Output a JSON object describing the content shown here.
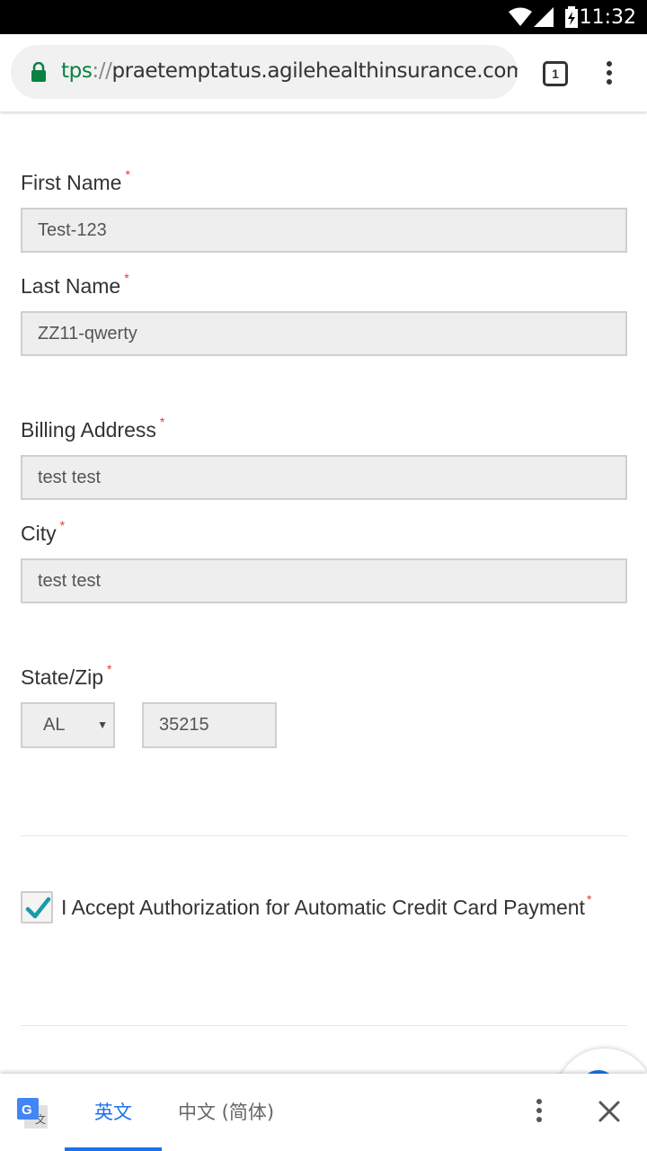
{
  "status_bar": {
    "time": "11:32"
  },
  "browser": {
    "url_scheme": "tps",
    "url_separator": "://",
    "url_host": "praetemptatus.agilehealthinsurance.com",
    "tab_count": "1"
  },
  "form": {
    "first_name": {
      "label": "First Name",
      "required_mark": "*",
      "value": "Test-123"
    },
    "last_name": {
      "label": "Last Name",
      "required_mark": "*",
      "value": "ZZ11-qwerty"
    },
    "billing_address": {
      "label": "Billing Address",
      "required_mark": "*",
      "value": "test test"
    },
    "city": {
      "label": "City",
      "required_mark": "*",
      "value": "test test"
    },
    "state_zip": {
      "label": "State/Zip",
      "required_mark": "*",
      "state": "AL",
      "zip": "35215"
    },
    "authorization": {
      "label": "I Accept Authorization for Automatic Credit Card Payment",
      "required_mark": "*",
      "checked": true
    }
  },
  "translate_bar": {
    "source_tab": "英文",
    "target_tab": "中文 (简体)"
  },
  "colors": {
    "accent": "#1a73e8",
    "secure_green": "#0b8043",
    "required_red": "#e53935",
    "check_teal": "#1a9aa8"
  },
  "icons": [
    "wifi-icon",
    "signal-icon",
    "battery-icon",
    "lock-icon",
    "more-vert-icon",
    "google-translate-icon",
    "close-icon",
    "check-icon"
  ]
}
